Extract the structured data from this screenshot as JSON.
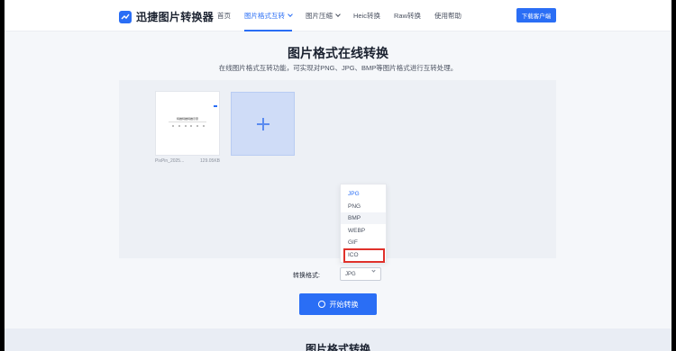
{
  "brand": {
    "name": "迅捷图片转换器",
    "accent": "#2a6ef5"
  },
  "nav": {
    "items": [
      {
        "label": "首页",
        "active": false,
        "has_menu": false
      },
      {
        "label": "图片格式互转",
        "active": true,
        "has_menu": true
      },
      {
        "label": "图片压缩",
        "active": false,
        "has_menu": true
      },
      {
        "label": "Heic转换",
        "active": false,
        "has_menu": false
      },
      {
        "label": "Raw转换",
        "active": false,
        "has_menu": false
      },
      {
        "label": "使用帮助",
        "active": false,
        "has_menu": false
      }
    ],
    "download_label": "下载客户端"
  },
  "hero": {
    "title": "图片格式在线转换",
    "subtitle": "在线图片格式互转功能，可实现对PNG、JPG、BMP等图片格式进行互转处理。"
  },
  "upload": {
    "file": {
      "name": "PixPin_2025...",
      "size": "129.05KB",
      "preview_title": "特推特推特推示意"
    }
  },
  "format_menu": {
    "options": [
      "JPG",
      "PNG",
      "BMP",
      "WEBP",
      "GIF",
      "ICO"
    ],
    "selected": "JPG",
    "hovered": "BMP",
    "highlighted": "ICO",
    "highlight_color": "#e0312b"
  },
  "format_row": {
    "label": "转换格式:",
    "value": "JPG"
  },
  "start_label": "开始转换",
  "footer_title": "图片格式转换"
}
